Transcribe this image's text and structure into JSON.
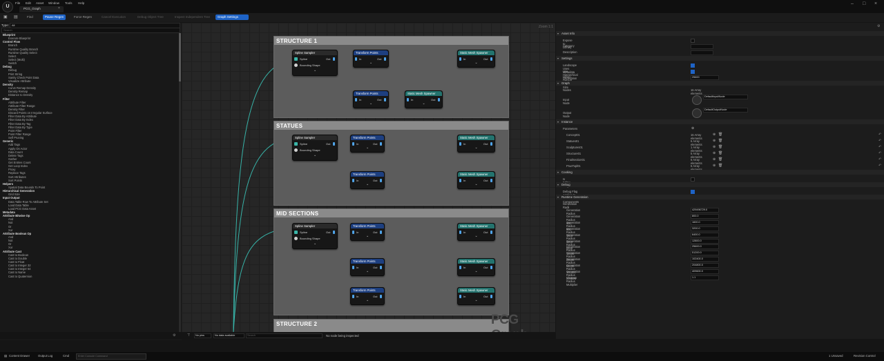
{
  "app": {
    "menu": [
      "File",
      "Edit",
      "Asset",
      "Window",
      "Tools",
      "Help"
    ],
    "tab_title": "PCG_Graph"
  },
  "toolbar": {
    "find": "Find",
    "pause_regen": "Pause Regen",
    "force_regen": "Force Regen",
    "cancel_execution": "Cancel Execution",
    "debug_object": "Debug Object Tree",
    "inspect_independent": "Inspect Independent Tree",
    "graph_settings": "Graph Settings"
  },
  "palette": {
    "type_label": "Type:",
    "type_value": "All",
    "search_placeholder": "Search",
    "rows": [
      {
        "t": "Blueprint",
        "c": 1
      },
      {
        "t": "Execute Blueprint",
        "c": 0
      },
      {
        "t": "Control Flow",
        "c": 1
      },
      {
        "t": "Branch",
        "c": 0
      },
      {
        "t": "Runtime Quality Branch",
        "c": 0
      },
      {
        "t": "Runtime Quality Select",
        "c": 0
      },
      {
        "t": "Select",
        "c": 0
      },
      {
        "t": "Select (Multi)",
        "c": 0
      },
      {
        "t": "Switch",
        "c": 0
      },
      {
        "t": "Debug",
        "c": 1
      },
      {
        "t": "Debug",
        "c": 0
      },
      {
        "t": "Print String",
        "c": 0
      },
      {
        "t": "Sanity Check Point Data",
        "c": 0
      },
      {
        "t": "Visualize Attribute",
        "c": 0
      },
      {
        "t": "Density",
        "c": 1
      },
      {
        "t": "Curve Remap Density",
        "c": 0
      },
      {
        "t": "Density Remap",
        "c": 0
      },
      {
        "t": "Distance to Density",
        "c": 0
      },
      {
        "t": "Filter",
        "c": 1
      },
      {
        "t": "Attribute Filter",
        "c": 0
      },
      {
        "t": "Attribute Filter Range",
        "c": 0
      },
      {
        "t": "Density Filter",
        "c": 0
      },
      {
        "t": "Discard Points on Irregular Surface",
        "c": 0
      },
      {
        "t": "Filter Data By Attribute",
        "c": 0
      },
      {
        "t": "Filter Data By Index",
        "c": 0
      },
      {
        "t": "Filter Data By Tag",
        "c": 0
      },
      {
        "t": "Filter Data By Type",
        "c": 0
      },
      {
        "t": "Point Filter",
        "c": 0
      },
      {
        "t": "Point Filter Range",
        "c": 0
      },
      {
        "t": "Self Pruning",
        "c": 0
      },
      {
        "t": "Generic",
        "c": 1
      },
      {
        "t": "Add Tags",
        "c": 0
      },
      {
        "t": "Apply On Actor",
        "c": 0
      },
      {
        "t": "Data Count",
        "c": 0
      },
      {
        "t": "Delete Tags",
        "c": 0
      },
      {
        "t": "Gather",
        "c": 0
      },
      {
        "t": "Get Entries Count",
        "c": 0
      },
      {
        "t": "Get Loop Index",
        "c": 0
      },
      {
        "t": "Proxy",
        "c": 0
      },
      {
        "t": "Replace Tags",
        "c": 0
      },
      {
        "t": "Sort Attributes",
        "c": 0
      },
      {
        "t": "Sort Points",
        "c": 0
      },
      {
        "t": "Helpers",
        "c": 1
      },
      {
        "t": "Spatial Data Bounds To Point",
        "c": 0
      },
      {
        "t": "Hierarchical Generation",
        "c": 1
      },
      {
        "t": "Grid Size",
        "c": 0
      },
      {
        "t": "Input Output",
        "c": 1
      },
      {
        "t": "Data Table Row To Attribute Set",
        "c": 0
      },
      {
        "t": "Load Data Table",
        "c": 0
      },
      {
        "t": "Load PCG Data Asset",
        "c": 0
      },
      {
        "t": "Metadata",
        "c": 1
      },
      {
        "t": "Attribute Bitwise Op",
        "c": 1
      },
      {
        "t": "And",
        "c": 0
      },
      {
        "t": "Not",
        "c": 0
      },
      {
        "t": "Or",
        "c": 0
      },
      {
        "t": "Xor",
        "c": 0
      },
      {
        "t": "Attribute Boolean Op",
        "c": 1
      },
      {
        "t": "And",
        "c": 0
      },
      {
        "t": "Not",
        "c": 0
      },
      {
        "t": "Or",
        "c": 0
      },
      {
        "t": "Xor",
        "c": 0
      },
      {
        "t": "Attribute Cast",
        "c": 1
      },
      {
        "t": "Cast to Boolean",
        "c": 0
      },
      {
        "t": "Cast to Double",
        "c": 0
      },
      {
        "t": "Cast to Float",
        "c": 0
      },
      {
        "t": "Cast to Integer 32",
        "c": 0
      },
      {
        "t": "Cast to Integer 64",
        "c": 0
      },
      {
        "t": "Cast to Name",
        "c": 0
      },
      {
        "t": "Cast to Quaternion",
        "c": 0
      }
    ]
  },
  "graph": {
    "zoom": "Zoom 1:1",
    "watermark": "PCG Graph",
    "comments": [
      "STRUCTURE 1",
      "STATUES",
      "MID SECTIONS",
      "STRUCTURE 2"
    ],
    "node_titles": {
      "sampler": "Spline Sampler",
      "transform": "Transform Points",
      "spawner": "Static Mesh Spawner"
    },
    "pins": {
      "spline": "Spline",
      "bounding": "Bounding Shape",
      "in": "In",
      "out": "Out"
    },
    "bottom": {
      "pins_label": "No pins",
      "data_label": "No data available",
      "search_placeholder": "Search",
      "status": "No node being inspected"
    }
  },
  "details": {
    "asset_info": "Asset Info",
    "expose_to_library": "Expose to Library",
    "category": "Category",
    "description": "Description",
    "settings": "Settings",
    "landscape_uses_metadata": "Landscape Uses Metadata",
    "use_hierarchical_generation": "Use Hierarchical Generation",
    "hi_gen_default_grid_size": "HiGen Default Grid Size",
    "grid_size_value": "25600",
    "graph": "Graph",
    "nodes": "Nodes",
    "nodes_value": "16 Array elements",
    "input_node": "Input Node",
    "input_node_value": "DefaultInputNode",
    "output_node": "Output Node",
    "output_node_value": "DefaultOutputNode",
    "instance": "Instance",
    "parameters": "Parameters",
    "params": [
      {
        "name": "Concept01",
        "value": "16 Array elements"
      },
      {
        "name": "Statues01",
        "value": "6 Array elements"
      },
      {
        "name": "Sculptures01",
        "value": "1 Array elements"
      },
      {
        "name": "Structure01",
        "value": "5 Array elements"
      },
      {
        "name": "FinalSection01",
        "value": "6 Array elements"
      },
      {
        "name": "PrueTopl01",
        "value": "6 Array elements"
      }
    ],
    "cooking": "Cooking",
    "is_editor_only": "Is Editor Only",
    "debug": "Debug",
    "debug_flag": "Debug Flag Applies to Individual Components",
    "runtime_generation": "Runtime Generation",
    "generation_radii": "Generation Radii",
    "radii": [
      {
        "name": "Generation Radius",
        "value": "429496729.0"
      },
      {
        "name": "Generation Radius 400",
        "value": "800.0"
      },
      {
        "name": "Generation Radius 800",
        "value": "1600.0"
      },
      {
        "name": "Generation Radius 1600",
        "value": "3200.0"
      },
      {
        "name": "Generation Radius 3200",
        "value": "6400.0"
      },
      {
        "name": "Generation Radius 6400",
        "value": "12800.0"
      },
      {
        "name": "Generation Radius 12800",
        "value": "25600.0"
      },
      {
        "name": "Generation Radius 25600",
        "value": "51200.0"
      },
      {
        "name": "Generation Radius 51200",
        "value": "102400.0"
      },
      {
        "name": "Generation Radius 102400",
        "value": "204800.0"
      },
      {
        "name": "Generation Radius 204800",
        "value": "409600.0"
      },
      {
        "name": "Cleanup Radius Multiplier",
        "value": "1.1"
      }
    ]
  },
  "status": {
    "content_drawer": "Content Drawer",
    "output_log": "Output Log",
    "cmd": "Cmd",
    "cmd_placeholder": "Enter Console Command",
    "unsaved": "1 Unsaved",
    "revision_control": "Revision Control"
  }
}
